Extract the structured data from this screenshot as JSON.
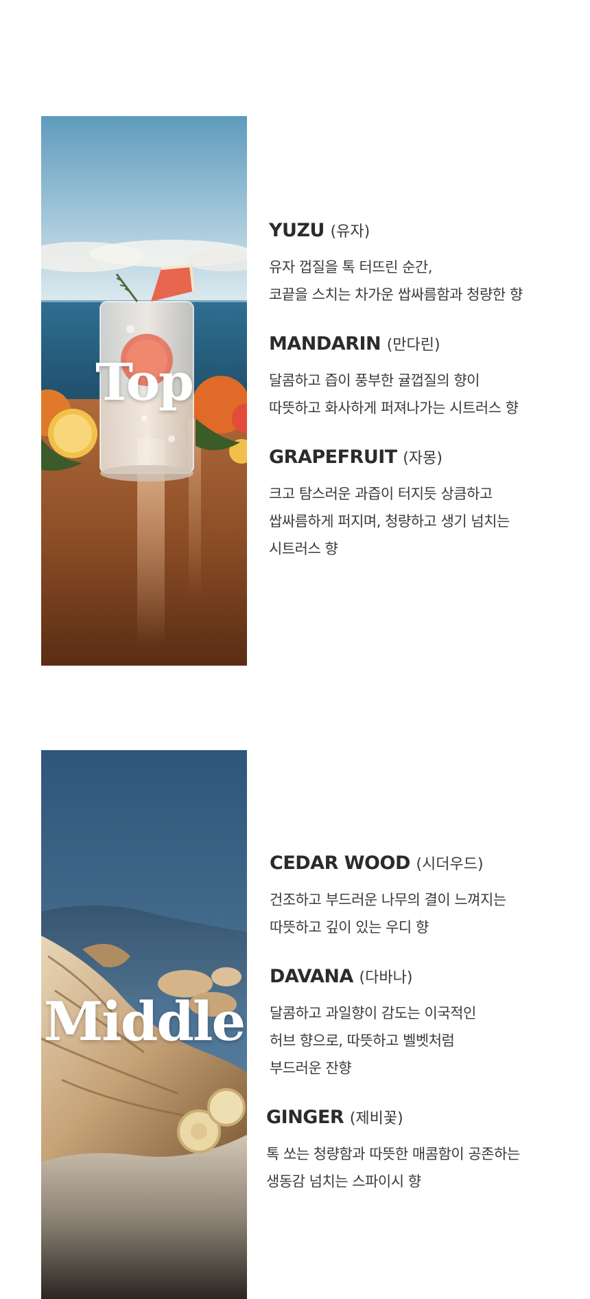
{
  "sections": {
    "top": {
      "label": "Top",
      "notes": [
        {
          "name": "YUZU",
          "korean": "(유자)",
          "lines": [
            "유자 껍질을 톡 터뜨린 순간,",
            "코끝을 스치는 차가운 쌉싸름함과 청량한 향"
          ]
        },
        {
          "name": "MANDARIN",
          "korean": "(만다린)",
          "lines": [
            "달콤하고 즙이 풍부한 귤껍질의 향이",
            "따뜻하고 화사하게 퍼져나가는 시트러스 향"
          ]
        },
        {
          "name": "GRAPEFRUIT",
          "korean": "(자몽)",
          "lines": [
            "크고 탐스러운 과즙이 터지듯 상큼하고",
            "쌉싸름하게 퍼지며, 청량하고 생기 넘치는",
            "시트러스 향"
          ]
        }
      ]
    },
    "middle": {
      "label": "Middle",
      "notes": [
        {
          "name": "CEDAR WOOD",
          "korean": "(시더우드)",
          "lines": [
            "건조하고 부드러운 나무의 결이 느껴지는",
            "따뜻하고 깊이 있는 우디 향"
          ]
        },
        {
          "name": "DAVANA",
          "korean": "(다바나)",
          "lines": [
            "달콤하고 과일향이 감도는 이국적인",
            "허브 향으로, 따뜻하고 벨벳처럼",
            "부드러운 잔향"
          ]
        },
        {
          "name": "GINGER",
          "korean": "(제비꽃)",
          "lines": [
            "톡 쏘는 청량함과 따뜻한 매콤함이 공존하는",
            "생동감 넘치는 스파이시 향"
          ]
        }
      ]
    }
  }
}
